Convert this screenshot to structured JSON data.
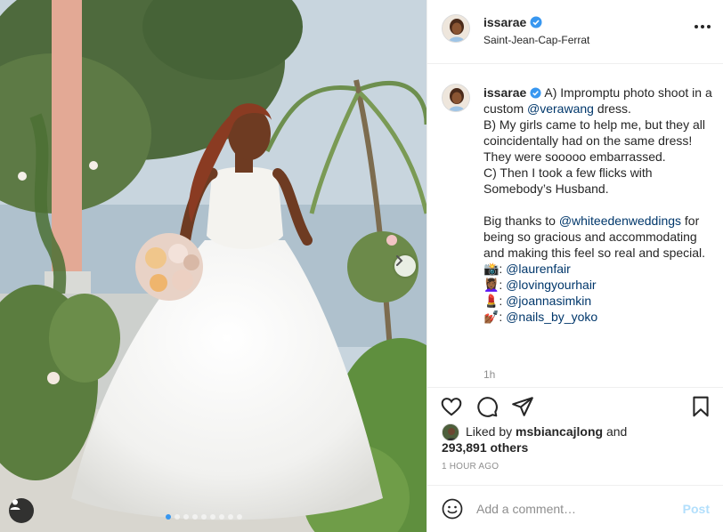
{
  "post": {
    "username": "issarae",
    "location": "Saint-Jean-Cap-Ferrat",
    "caption_segments": [
      {
        "text": "A) Impromptu photo shoot in a custom ",
        "mention": false
      },
      {
        "text": "@verawang",
        "mention": true
      },
      {
        "text": " dress.\nB) My girls came to help me, but they all coincidentally had on the same dress! They were sooooo embarrassed.\nC) Then I took a few flicks with Somebody’s Husband.\n\nBig thanks to ",
        "mention": false
      },
      {
        "text": "@whiteedenweddings",
        "mention": true
      },
      {
        "text": " for being so gracious and accommodating and making this feel so real and special.\n📸: ",
        "mention": false
      },
      {
        "text": "@laurenfair",
        "mention": true
      },
      {
        "text": "\n💆🏾‍♀️: ",
        "mention": false
      },
      {
        "text": "@lovingyourhair",
        "mention": true
      },
      {
        "text": "\n💄: ",
        "mention": false
      },
      {
        "text": "@joannasimkin",
        "mention": true
      },
      {
        "text": "\n💅🏾: ",
        "mention": false
      },
      {
        "text": "@nails_by_yoko",
        "mention": true
      }
    ],
    "comment_age": "1h",
    "likes": {
      "prefix": "Liked by ",
      "user": "msbiancajlong",
      "connector": " and",
      "others": "293,891 others"
    },
    "posted_ago": "1 HOUR AGO",
    "carousel": {
      "count": 9,
      "active_index": 0
    }
  },
  "comment_box": {
    "placeholder": "Add a comment…",
    "post_label": "Post"
  },
  "icons": {
    "verified": "verified-badge-icon",
    "like": "heart-icon",
    "comment": "comment-bubble-icon",
    "share": "paper-plane-icon",
    "save": "bookmark-icon",
    "emoji": "smiley-icon",
    "more": "ellipsis-icon",
    "next": "chevron-right-icon",
    "tags": "user-tag-icon"
  },
  "colors": {
    "verified": "#3897f0",
    "mention": "#00376b",
    "post_disabled": "#b2dffc",
    "muted": "#8e8e8e"
  }
}
